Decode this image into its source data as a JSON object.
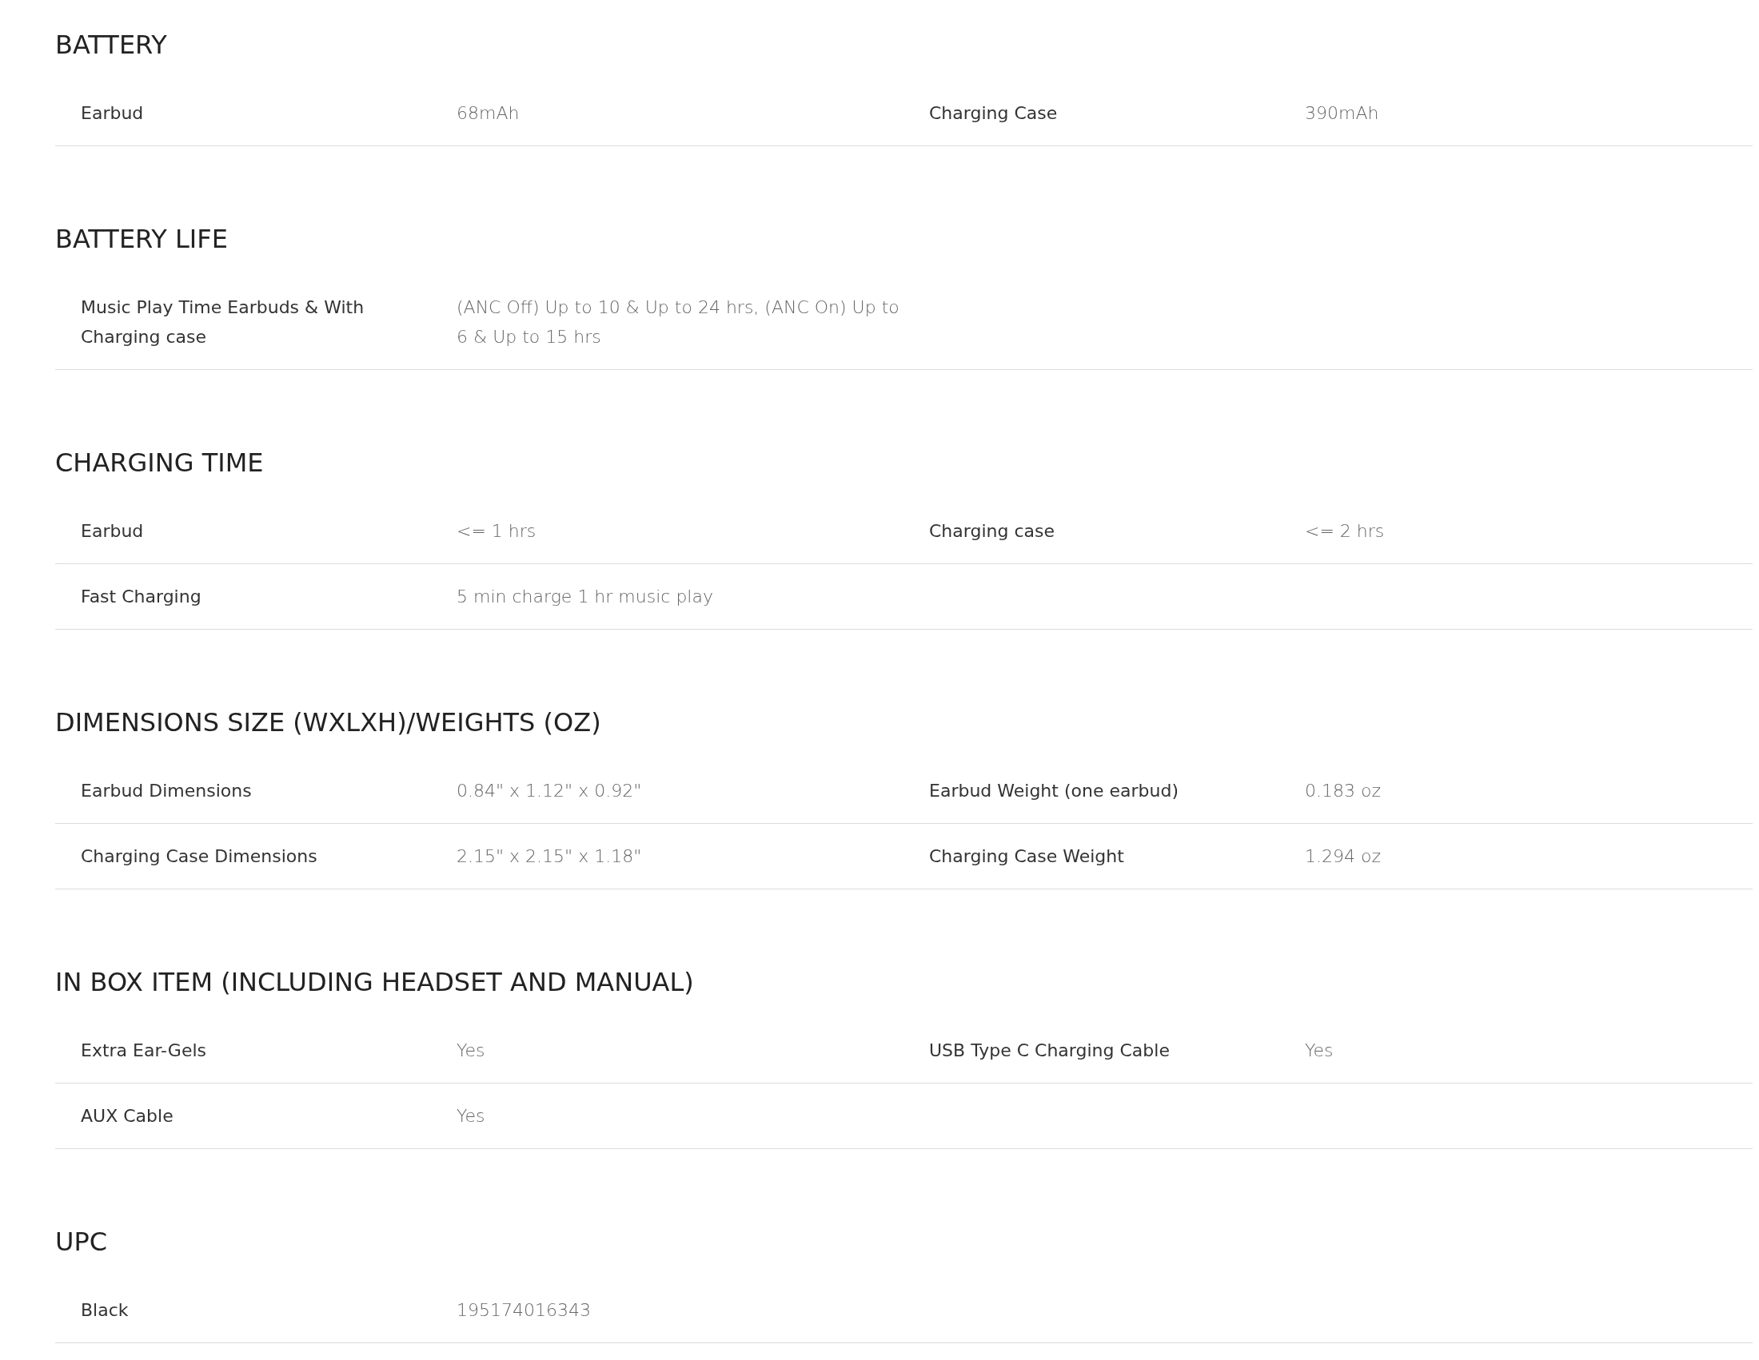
{
  "sections": [
    {
      "title": "BATTERY",
      "rows": [
        [
          {
            "label": "Earbud",
            "value": "68mAh"
          },
          {
            "label": "Charging Case",
            "value": "390mAh"
          }
        ]
      ]
    },
    {
      "title": "BATTERY LIFE",
      "rows": [
        [
          {
            "label": "Music Play Time Earbuds & With Charging case",
            "value": "(ANC Off) Up to 10 & Up to 24 hrs, (ANC On) Up to 6 & Up to 15 hrs"
          }
        ]
      ]
    },
    {
      "title": "CHARGING TIME",
      "rows": [
        [
          {
            "label": "Earbud",
            "value": "<= 1 hrs"
          },
          {
            "label": "Charging case",
            "value": "<= 2 hrs"
          }
        ],
        [
          {
            "label": "Fast Charging",
            "value": "5 min charge 1 hr music play"
          }
        ]
      ]
    },
    {
      "title": "DIMENSIONS SIZE (WXLXH)/WEIGHTS (OZ)",
      "rows": [
        [
          {
            "label": "Earbud Dimensions",
            "value": "0.84\" x 1.12\" x 0.92\""
          },
          {
            "label": "Earbud Weight (one earbud)",
            "value": "0.183 oz"
          }
        ],
        [
          {
            "label": "Charging Case Dimensions",
            "value": "2.15\" x 2.15\" x 1.18\""
          },
          {
            "label": "Charging Case Weight",
            "value": "1.294 oz"
          }
        ]
      ]
    },
    {
      "title": "IN BOX ITEM (INCLUDING HEADSET AND MANUAL)",
      "rows": [
        [
          {
            "label": "Extra Ear-Gels",
            "value": "Yes"
          },
          {
            "label": "USB Type C Charging Cable",
            "value": "Yes"
          }
        ],
        [
          {
            "label": "AUX Cable",
            "value": "Yes"
          }
        ]
      ]
    },
    {
      "title": "UPC",
      "rows": [
        [
          {
            "label": "Black",
            "value": "195174016343"
          }
        ]
      ]
    }
  ]
}
